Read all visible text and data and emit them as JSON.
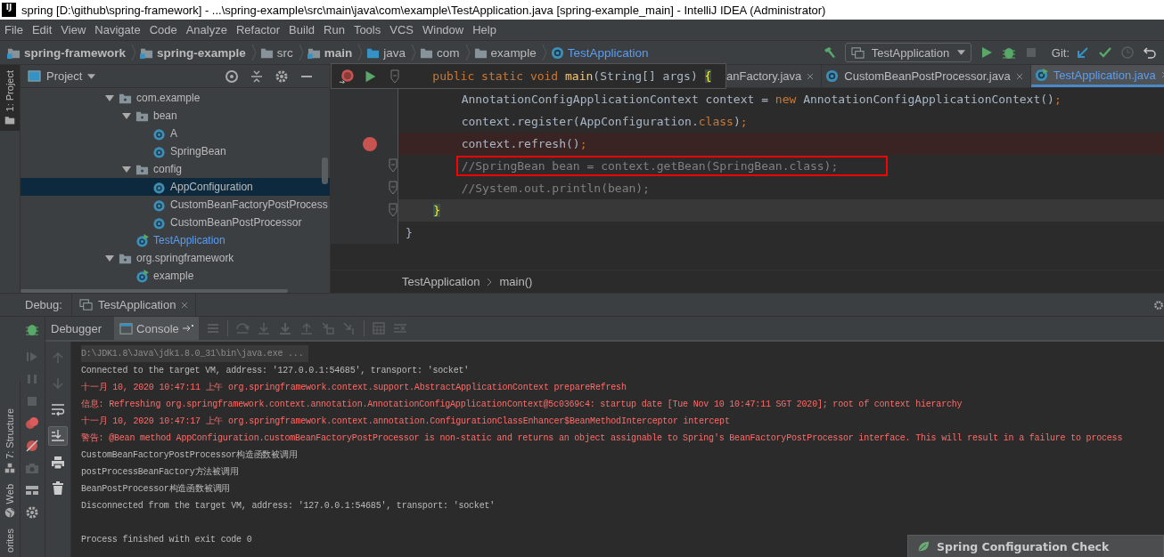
{
  "window": {
    "logo": "IJ",
    "title": "spring [D:\\github\\spring-framework] - ...\\spring-example\\src\\main\\java\\com\\example\\TestApplication.java [spring-example_main] - IntelliJ IDEA (Administrator)"
  },
  "menu": [
    "File",
    "Edit",
    "View",
    "Navigate",
    "Code",
    "Analyze",
    "Refactor",
    "Build",
    "Run",
    "Tools",
    "VCS",
    "Window",
    "Help"
  ],
  "breadcrumbs": [
    {
      "label": "spring-framework",
      "kind": "module"
    },
    {
      "label": "spring-example",
      "kind": "module"
    },
    {
      "label": "src",
      "kind": "folder"
    },
    {
      "label": "main",
      "kind": "source"
    },
    {
      "label": "java",
      "kind": "java"
    },
    {
      "label": "com",
      "kind": "package"
    },
    {
      "label": "example",
      "kind": "package"
    },
    {
      "label": "TestApplication",
      "kind": "class"
    }
  ],
  "run_toolbar": {
    "config": "TestApplication",
    "vcs_label": "Git:",
    "stop_disabled": true
  },
  "left_strip": {
    "top_tabs": [
      {
        "label": "1: Project",
        "kind": "project",
        "selected": true
      }
    ],
    "bottom_tabs": [
      {
        "label": "7: Structure",
        "kind": "structure",
        "selected": false
      },
      {
        "label": "Web",
        "kind": "web",
        "selected": false
      },
      {
        "label": "orites",
        "kind": "favorites",
        "selected": false
      }
    ]
  },
  "project_panel": {
    "title": "Project",
    "tree": [
      {
        "label": "com.example",
        "kind": "package",
        "expanded": true,
        "selected": false,
        "modified": false,
        "children": [
          {
            "label": "bean",
            "kind": "package",
            "expanded": true,
            "selected": false,
            "modified": false,
            "children": [
              {
                "label": "A",
                "kind": "class",
                "selected": false,
                "modified": false
              },
              {
                "label": "SpringBean",
                "kind": "class",
                "selected": false,
                "modified": false
              }
            ]
          },
          {
            "label": "config",
            "kind": "package",
            "expanded": true,
            "selected": false,
            "modified": false,
            "children": [
              {
                "label": "AppConfiguration",
                "kind": "class",
                "selected": true,
                "modified": false
              },
              {
                "label": "CustomBeanFactoryPostProcess",
                "kind": "class",
                "selected": false,
                "modified": false
              },
              {
                "label": "CustomBeanPostProcessor",
                "kind": "class",
                "selected": false,
                "modified": false
              }
            ]
          },
          {
            "label": "TestApplication",
            "kind": "runnable",
            "selected": false,
            "modified": true
          }
        ]
      },
      {
        "label": "org.springframework",
        "kind": "package",
        "expanded": true,
        "selected": false,
        "modified": false,
        "children": [
          {
            "label": "example",
            "kind": "runnable",
            "selected": false,
            "modified": false
          }
        ]
      }
    ]
  },
  "editor": {
    "tabs": [
      {
        "label": "anFactory.java",
        "covered": true,
        "selected": false
      },
      {
        "label": "CustomBeanPostProcessor.java",
        "covered": false,
        "selected": false
      },
      {
        "label": "TestApplication.java",
        "covered": false,
        "selected": true
      }
    ],
    "popup": [
      {
        "text": "    public static void ",
        "kind": "keyword"
      },
      {
        "text": "main",
        "kind": "method"
      },
      {
        "text": "(String[] args) ",
        "kind": "plain"
      },
      {
        "text": "{",
        "kind": "match"
      }
    ],
    "lines": [
      {
        "breakpoint": false,
        "boxed": false,
        "current": false,
        "fold": false,
        "tokens": [
          {
            "text": "        AnnotationConfigApplicationContext context = ",
            "kind": "plain"
          },
          {
            "text": "new ",
            "kind": "keyword"
          },
          {
            "text": "AnnotationConfigApplicationContext()",
            "kind": "plain"
          },
          {
            "text": ";",
            "kind": "keyword"
          }
        ]
      },
      {
        "breakpoint": false,
        "boxed": false,
        "current": false,
        "fold": false,
        "tokens": [
          {
            "text": "        context.register(AppConfiguration.",
            "kind": "plain"
          },
          {
            "text": "class",
            "kind": "keyword"
          },
          {
            "text": ")",
            "kind": "plain"
          },
          {
            "text": ";",
            "kind": "keyword"
          }
        ]
      },
      {
        "breakpoint": true,
        "boxed": false,
        "current": false,
        "fold": false,
        "tokens": [
          {
            "text": "        context.refresh()",
            "kind": "plain"
          },
          {
            "text": ";",
            "kind": "keyword"
          }
        ]
      },
      {
        "breakpoint": false,
        "boxed": true,
        "current": false,
        "fold": true,
        "tokens": [
          {
            "text": "        //SpringBean bean = context.getBean(SpringBean.class);",
            "kind": "comment"
          }
        ]
      },
      {
        "breakpoint": false,
        "boxed": false,
        "current": false,
        "fold": true,
        "tokens": [
          {
            "text": "        //System.out.println(bean);",
            "kind": "comment"
          }
        ]
      },
      {
        "breakpoint": false,
        "boxed": false,
        "current": true,
        "fold": true,
        "tokens": [
          {
            "text": "    }",
            "kind": "match"
          }
        ]
      },
      {
        "breakpoint": false,
        "boxed": false,
        "current": false,
        "fold": false,
        "tokens": [
          {
            "text": "}",
            "kind": "plain"
          }
        ]
      }
    ],
    "breadcrumb": [
      "TestApplication",
      "main()"
    ]
  },
  "debug": {
    "label": "Debug:",
    "session": "TestApplication",
    "tabs": [
      {
        "label": "Debugger",
        "selected": false
      },
      {
        "label": "Console",
        "selected": true
      }
    ],
    "console": [
      {
        "kind": "command",
        "text": "D:\\JDK1.8\\Java\\jdk1.8.0_31\\bin\\java.exe ..."
      },
      {
        "kind": "normal",
        "text": "Connected to the target VM, address: '127.0.0.1:54685', transport: 'socket'"
      },
      {
        "kind": "error",
        "text": "十一月 10, 2020 10:47:11 上午 org.springframework.context.support.AbstractApplicationContext prepareRefresh"
      },
      {
        "kind": "error",
        "text": "信息: Refreshing org.springframework.context.annotation.AnnotationConfigApplicationContext@5c0369c4: startup date [Tue Nov 10 10:47:11 SGT 2020]; root of context hierarchy"
      },
      {
        "kind": "error",
        "text": "十一月 10, 2020 10:47:17 上午 org.springframework.context.annotation.ConfigurationClassEnhancer$BeanMethodInterceptor intercept"
      },
      {
        "kind": "error",
        "text": "警告: @Bean method AppConfiguration.customBeanFactoryPostProcessor is non-static and returns an object assignable to Spring's BeanFactoryPostProcessor interface. This will result in a failure to process"
      },
      {
        "kind": "normal",
        "text": "CustomBeanFactoryPostProcessor构造函数被调用"
      },
      {
        "kind": "normal",
        "text": "postProcessBeanFactory方法被调用"
      },
      {
        "kind": "normal",
        "text": "BeanPostProcessor构造函数被调用"
      },
      {
        "kind": "normal",
        "text": "Disconnected from the target VM, address: '127.0.0.1:54685', transport: 'socket'"
      },
      {
        "kind": "exit",
        "text": "Process finished with exit code 0"
      }
    ]
  },
  "notification": {
    "title": "Spring Configuration Check"
  }
}
